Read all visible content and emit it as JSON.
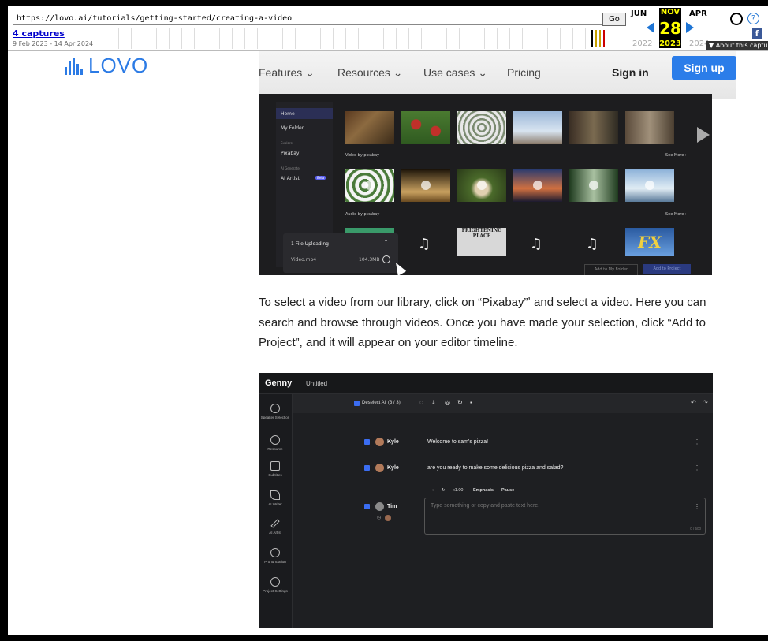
{
  "wayback": {
    "url": "https://lovo.ai/tutorials/getting-started/creating-a-video",
    "go_label": "Go",
    "captures_label": "4 captures",
    "date_range": "9 Feb 2023 - 14 Apr 2024",
    "months": {
      "prev": "JUN",
      "current": "NOV",
      "next": "APR"
    },
    "day": "28",
    "years": {
      "prev": "2022",
      "current": "2023",
      "next": "2024"
    },
    "about_label": "▼ About this capture",
    "facebook_label": "f",
    "help_label": "?"
  },
  "header": {
    "logo_text": "LOVO",
    "nav": {
      "features": "Features ⌄",
      "resources": "Resources ⌄",
      "use_cases": "Use cases ⌄",
      "pricing": "Pricing"
    },
    "sign_in": "Sign in",
    "sign_up": "Sign up"
  },
  "shot1": {
    "sidebar": {
      "home": "Home",
      "my_folder": "My Folder",
      "explore": "Explore",
      "pixabay": "Pixabay",
      "ai_generate": "AI Generate",
      "ai_artist": "AI Artist",
      "beta": "Beta"
    },
    "video_by": "Video by pixabay",
    "audio_by": "Audio by pixabay",
    "see_more": "See More ›",
    "upload_title": "1 File Uploading",
    "upload_file": "Video.mp4",
    "upload_size": "104.3MB",
    "audio_title_text": "FRIGHTENING PLACE",
    "fx_text": "FX",
    "add_to_folder": "Add to My Folder",
    "add_to_project": "Add to Project"
  },
  "paragraph": "To select a video from our library, click on “Pixabay”ʼ and select a video. Here you can search and browse through videos. Once you have made your selection, click “Add to Project”, and it will appear on your editor timeline.",
  "shot2": {
    "logo": "Genny",
    "title": "Untitled",
    "sidebar": {
      "speaker": "Speaker Selection",
      "resource": "Resource",
      "subtitles": "Subtitles",
      "ai_writer": "AI Writer",
      "ai_artist": "AI Artist",
      "pronunciation": "Pronunciation",
      "project_settings": "Project Settings"
    },
    "deselect": "Deselect All (3 / 3)",
    "rows": [
      {
        "speaker": "Kyle",
        "text": "Welcome to sam's pizza!"
      },
      {
        "speaker": "Kyle",
        "text": "are you ready to make some delicious pizza and salad?"
      },
      {
        "speaker": "Tim",
        "text": "Type something or copy and paste text here."
      }
    ],
    "speed": "x1.00",
    "emphasis": "Emphasis",
    "pause": "Pause",
    "counter": "0 / 500"
  }
}
